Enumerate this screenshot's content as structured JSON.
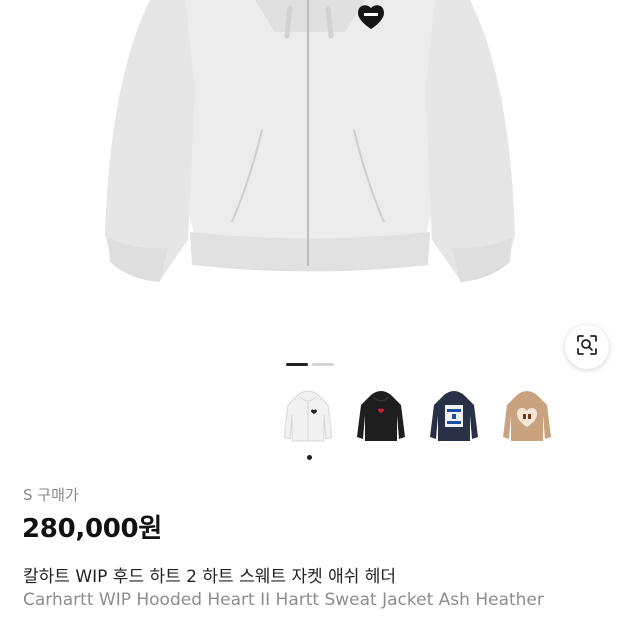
{
  "hero": {
    "icon": "zip-hoodie-image",
    "color": "#ececec"
  },
  "lens_button": {
    "icon": "image-search-icon"
  },
  "pager": {
    "count": 2,
    "active": 0
  },
  "thumbnails": [
    {
      "icon": "white-hoodie-thumb",
      "color": "#f2f2f2"
    },
    {
      "icon": "black-hoodie-thumb",
      "color": "#1e1e1e"
    },
    {
      "icon": "navy-hoodie-thumb",
      "color": "#2a3046"
    },
    {
      "icon": "beige-hoodie-thumb",
      "color": "#c9a27f"
    }
  ],
  "selected_thumbnail": 0,
  "size_label": "S 구매가",
  "price": "280,000원",
  "title_ko": "칼하트 WIP 후드 하트 2 하트 스웨트 자켓 애쉬 헤더",
  "title_en": "Carhartt WIP Hooded Heart II Hartt Sweat Jacket Ash Heather"
}
